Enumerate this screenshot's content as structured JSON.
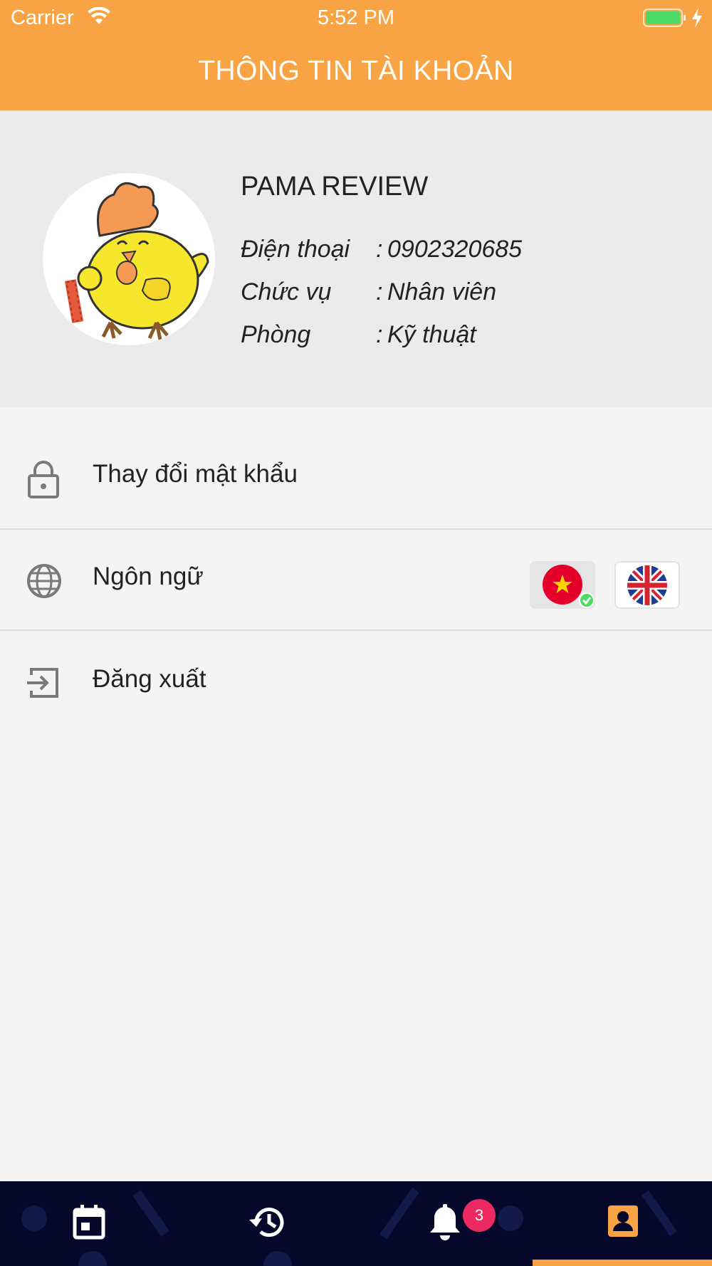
{
  "status_bar": {
    "carrier": "Carrier",
    "time": "5:52 PM",
    "wifi_icon": "wifi-icon",
    "battery_icon": "battery-icon",
    "charging_icon": "charging-bolt-icon"
  },
  "header": {
    "title": "THÔNG TIN TÀI KHOẢN",
    "color": "#f8a444"
  },
  "profile": {
    "name": "PAMA REVIEW",
    "fields": [
      {
        "label": "Điện thoại",
        "separator": ":",
        "value": "0902320685"
      },
      {
        "label": "Chức vụ",
        "separator": ":",
        "value": "Nhân viên"
      },
      {
        "label": "Phòng",
        "separator": ":",
        "value": "Kỹ thuật"
      }
    ],
    "avatar_icon": "chicken-mascot-avatar"
  },
  "menu": [
    {
      "label": "Thay đổi mật khẩu",
      "icon": "lock-icon"
    },
    {
      "label": "Ngôn ngữ",
      "icon": "globe-icon"
    },
    {
      "label": "Đăng xuất",
      "icon": "logout-icon"
    }
  ],
  "language": {
    "options": [
      {
        "code": "vi",
        "icon": "vietnam-flag-icon",
        "selected": true
      },
      {
        "code": "en",
        "icon": "uk-flag-icon",
        "selected": false
      }
    ]
  },
  "tab_bar": {
    "tabs": [
      {
        "icon": "calendar-icon",
        "active": false
      },
      {
        "icon": "history-icon",
        "active": false
      },
      {
        "icon": "bell-icon",
        "active": false
      },
      {
        "icon": "person-icon",
        "active": true
      }
    ],
    "notification_count": "3",
    "background": "#05082b",
    "active_color": "#f8a444",
    "badge_color": "#ec2a61"
  }
}
